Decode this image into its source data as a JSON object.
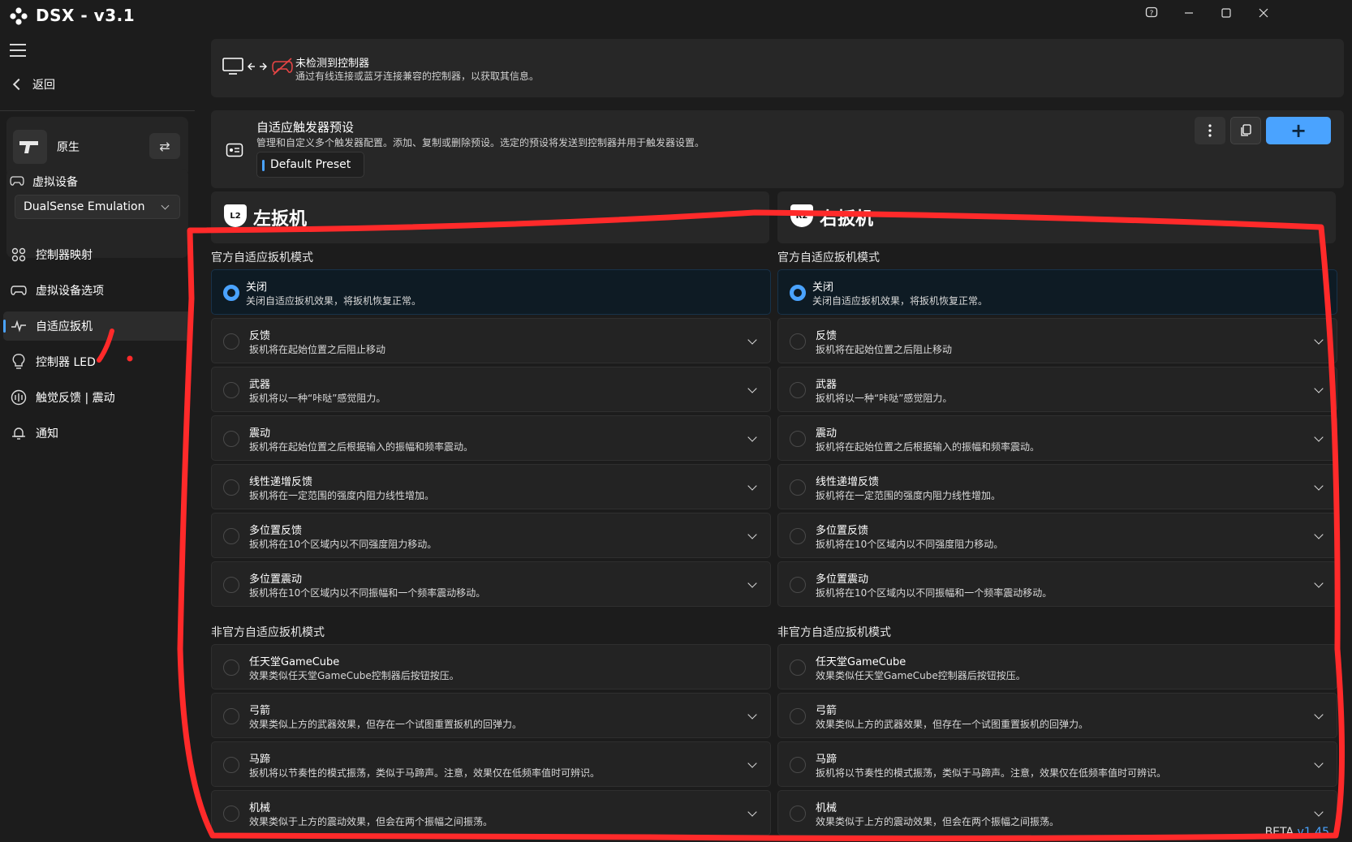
{
  "app": {
    "title": "DSX - v3.1",
    "window_controls": [
      "help-icon",
      "minimize-icon",
      "maximize-icon",
      "close-icon"
    ]
  },
  "sidebar": {
    "back_label": "返回",
    "profile": {
      "name": "原生"
    },
    "virtual_device": {
      "label": "虚拟设备",
      "selected": "DualSense Emulation"
    },
    "nav": [
      {
        "label": "控制器映射",
        "icon": "controller-mapping-icon"
      },
      {
        "label": "虚拟设备选项",
        "icon": "gamepad-icon"
      },
      {
        "label": "自适应扳机",
        "icon": "pulse-icon",
        "active": true
      },
      {
        "label": "控制器 LED",
        "icon": "bulb-icon"
      },
      {
        "label": "触觉反馈 | 震动",
        "icon": "haptics-icon"
      },
      {
        "label": "通知",
        "icon": "bell-icon"
      }
    ]
  },
  "status": {
    "title": "未检测到控制器",
    "description": "通过有线连接或蓝牙连接兼容的控制器，以获取其信息。"
  },
  "preset": {
    "title": "自适应触发器预设",
    "description": "管理和自定义多个触发器配置。添加、复制或删除预设。选定的预设将发送到控制器并用于触发器设置。",
    "current": "Default Preset",
    "add_label": "+"
  },
  "left_trigger": {
    "badge": "L2",
    "title": "左扳机",
    "official_label": "官方自适应扳机模式",
    "unofficial_label": "非官方自适应扳机模式"
  },
  "right_trigger": {
    "badge": "R2",
    "title": "右扳机",
    "official_label": "官方自适应扳机模式",
    "unofficial_label": "非官方自适应扳机模式"
  },
  "official_modes": [
    {
      "title": "关闭",
      "desc": "关闭自适应扳机效果，将扳机恢复正常。",
      "selected": true,
      "expandable": false
    },
    {
      "title": "反馈",
      "desc": "扳机将在起始位置之后阻止移动",
      "expandable": true
    },
    {
      "title": "武器",
      "desc": "扳机将以一种“咔哒”感觉阻力。",
      "expandable": true
    },
    {
      "title": "震动",
      "desc": "扳机将在起始位置之后根据输入的振幅和频率震动。",
      "expandable": true
    },
    {
      "title": "线性递增反馈",
      "desc": "扳机将在一定范围的强度内阻力线性增加。",
      "expandable": true
    },
    {
      "title": "多位置反馈",
      "desc": "扳机将在10个区域内以不同强度阻力移动。",
      "expandable": true
    },
    {
      "title": "多位置震动",
      "desc": "扳机将在10个区域内以不同振幅和一个频率震动移动。",
      "expandable": true
    }
  ],
  "unofficial_modes": [
    {
      "title": "任天堂GameCube",
      "desc": "效果类似任天堂GameCube控制器后按钮按压。",
      "expandable": false
    },
    {
      "title": "弓箭",
      "desc": "效果类似上方的武器效果，但存在一个试图重置扳机的回弹力。",
      "expandable": true
    },
    {
      "title": "马蹄",
      "desc": "扳机将以节奏性的模式振荡，类似于马蹄声。注意，效果仅在低频率值时可辨识。",
      "expandable": true
    },
    {
      "title": "机械",
      "desc": "效果类似于上方的震动效果，但会在两个振幅之间振荡。",
      "expandable": true
    }
  ],
  "footer": {
    "beta": "BETA",
    "version": "v1.45"
  },
  "colors": {
    "accent": "#4aa3ff",
    "background": "#1c1c1c",
    "panel": "#272727",
    "annotation": "#ff2a2a"
  }
}
